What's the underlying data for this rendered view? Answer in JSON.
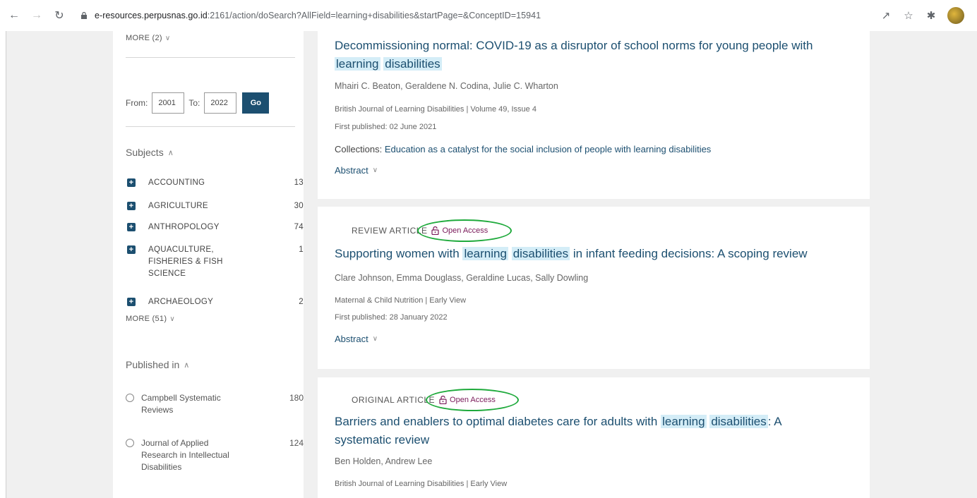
{
  "browser": {
    "url_host": "e-resources.perpusnas.go.id",
    "url_rest": ":2161/action/doSearch?AllField=learning+disabilities&startPage=&ConceptID=15941"
  },
  "sidebar": {
    "more_top": "MORE (2)",
    "date_filter": {
      "from_label": "From:",
      "from_value": "2001",
      "to_label": "To:",
      "to_value": "2022",
      "go_label": "Go"
    },
    "subjects": {
      "heading": "Subjects",
      "items": [
        {
          "label": "ACCOUNTING",
          "count": "13"
        },
        {
          "label": "AGRICULTURE",
          "count": "30"
        },
        {
          "label": "ANTHROPOLOGY",
          "count": "74"
        },
        {
          "label": "AQUACULTURE, FISHERIES & FISH SCIENCE",
          "count": "1"
        },
        {
          "label": "ARCHAEOLOGY",
          "count": "2"
        }
      ],
      "more": "MORE (51)"
    },
    "published_in": {
      "heading": "Published in",
      "items": [
        {
          "label": "Campbell Systematic Reviews",
          "count": "180"
        },
        {
          "label": "Journal of Applied Research in Intellectual Disabilities",
          "count": "124"
        }
      ]
    }
  },
  "results": [
    {
      "title_pre": "Decommissioning normal: COVID-19 as a disruptor of school norms for young people with",
      "hl1": "learning",
      "hl2": "disabilities",
      "title_post": "",
      "authors": "Mhairi C. Beaton, Geraldene N. Codina, Julie C. Wharton",
      "journal": "British Journal of Learning Disabilities | Volume 49, Issue 4",
      "published": "First published: 02 June 2021",
      "collections_label": "Collections:",
      "collections_value": "Education as a catalyst for the social inclusion of people with learning disabilities",
      "abstract_label": "Abstract"
    },
    {
      "type": "REVIEW ARTICLE",
      "open_access": "Open Access",
      "title_pre": "Supporting women with",
      "hl1": "learning",
      "hl2": "disabilities",
      "title_post": "in infant feeding decisions: A scoping review",
      "authors": "Clare Johnson, Emma Douglass, Geraldine Lucas, Sally Dowling",
      "journal": "Maternal & Child Nutrition | Early View",
      "published": "First published: 28 January 2022",
      "abstract_label": "Abstract"
    },
    {
      "type": "ORIGINAL ARTICLE",
      "open_access": "Open Access",
      "title_pre": "Barriers and enablers to optimal diabetes care for adults with",
      "hl1": "learning",
      "hl2": "disabilities",
      "title_post": ": A",
      "title_line2": "systematic review",
      "authors": "Ben Holden, Andrew Lee",
      "journal": "British Journal of Learning Disabilities | Early View"
    }
  ],
  "colors": {
    "accent": "#1c4f70",
    "highlight": "#d4edf7",
    "annotation_ring": "#1faa3c",
    "open_access": "#7a1a5a"
  }
}
